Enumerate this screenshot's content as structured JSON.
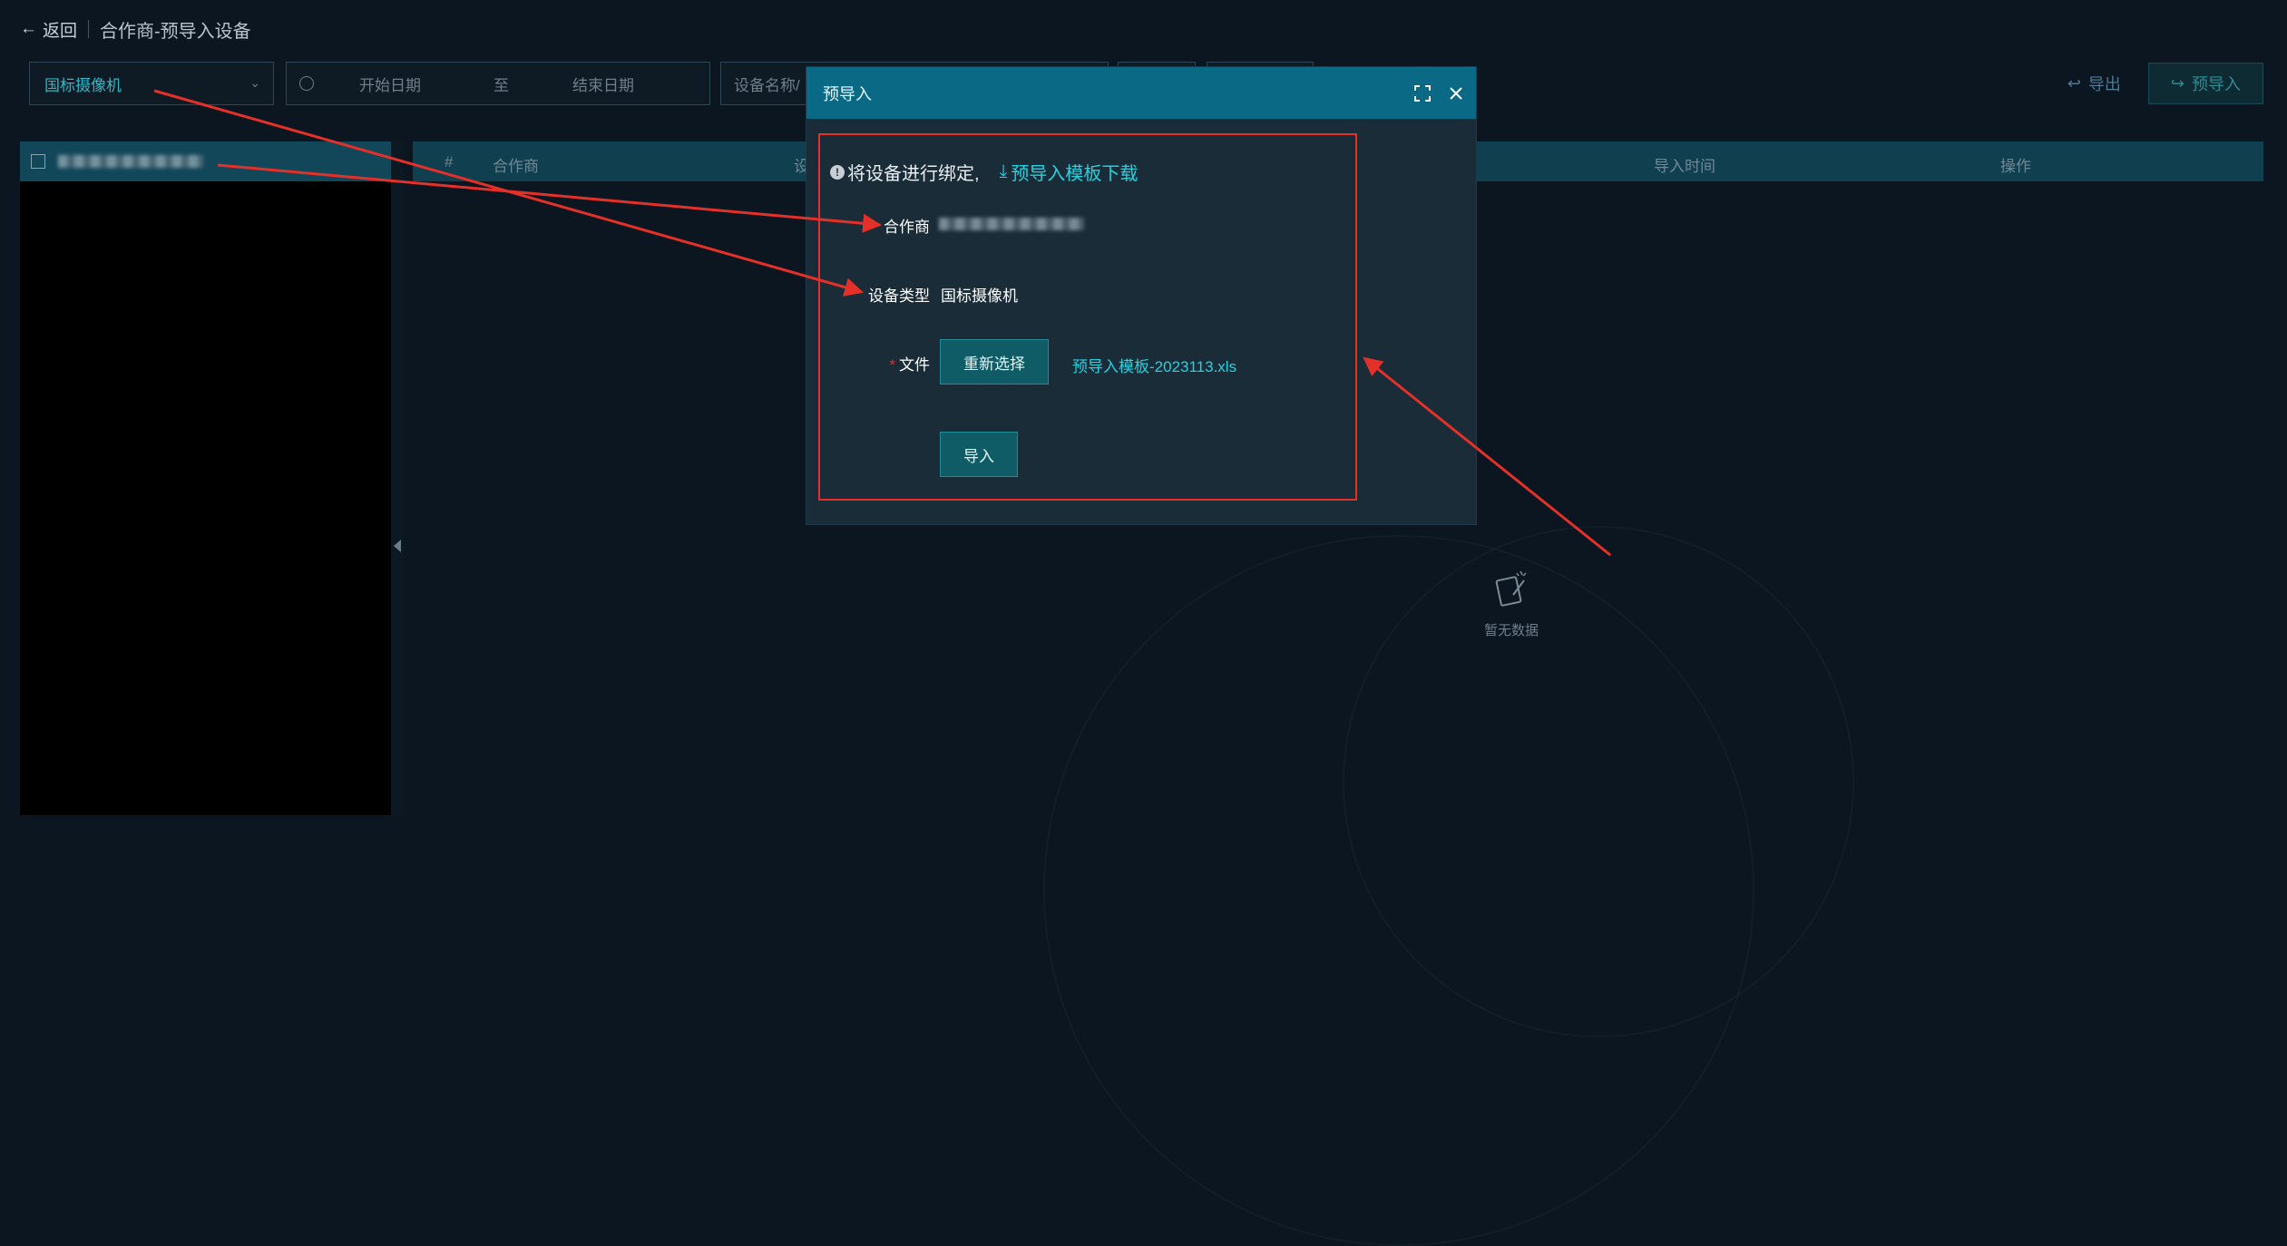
{
  "topbar": {
    "back_label": "返回",
    "title": "合作商-预导入设备"
  },
  "filters": {
    "device_type": "国标摄像机",
    "start_placeholder": "开始日期",
    "to": "至",
    "end_placeholder": "结束日期",
    "name_placeholder": "设备名称/"
  },
  "actions": {
    "export": "导出",
    "preimport": "预导入"
  },
  "table": {
    "columns": [
      "#",
      "合作商",
      "设",
      "导入时间",
      "操作"
    ]
  },
  "empty": {
    "text": "暂无数据"
  },
  "modal": {
    "title": "预导入",
    "notice": "将设备进行绑定,",
    "template_link": "预导入模板下载",
    "partner_label": "合作商",
    "device_type_label": "设备类型",
    "device_type_value": "国标摄像机",
    "file_label": "文件",
    "reselect_button": "重新选择",
    "file_name": "预导入模板-2023113.xls",
    "import_button": "导入"
  },
  "colors": {
    "accent": "#1fd4e0",
    "header": "#0a6a86",
    "highlight": "#e5302a"
  }
}
